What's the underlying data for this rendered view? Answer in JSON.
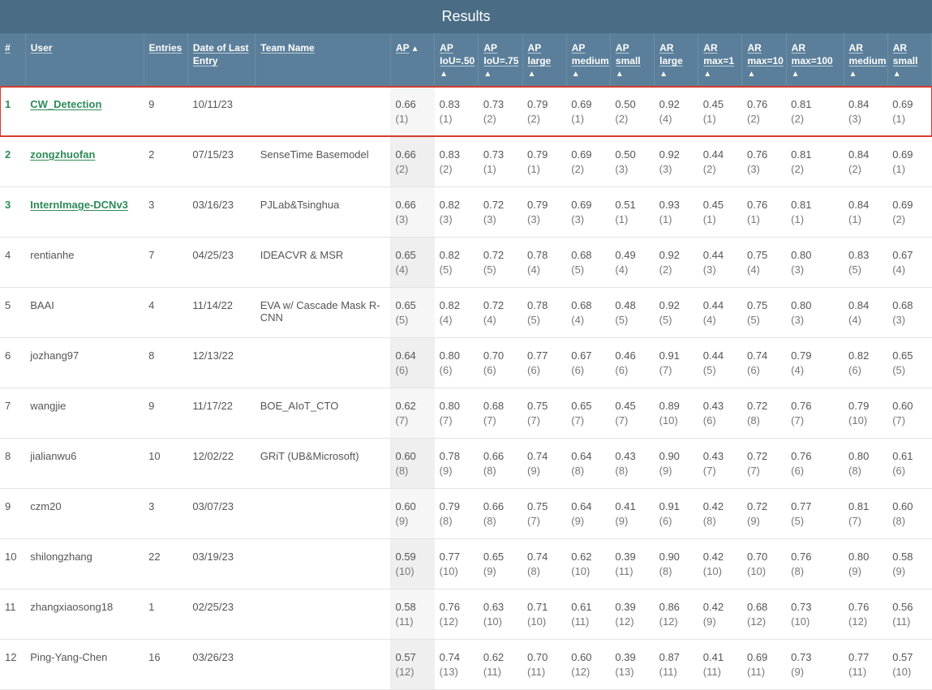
{
  "title": "Results",
  "columns": [
    {
      "label": "#",
      "sortable": false
    },
    {
      "label": "User",
      "sortable": false
    },
    {
      "label": "Entries",
      "sortable": false
    },
    {
      "label": "Date of Last Entry",
      "sortable": false
    },
    {
      "label": "Team Name",
      "sortable": false
    },
    {
      "label": "AP",
      "sortable": true,
      "arrow_inline": true
    },
    {
      "label": "AP IoU=.50",
      "sortable": true
    },
    {
      "label": "AP IoU=.75",
      "sortable": true
    },
    {
      "label": "AP large",
      "sortable": true
    },
    {
      "label": "AP medium",
      "sortable": true
    },
    {
      "label": "AP small",
      "sortable": true
    },
    {
      "label": "AR large",
      "sortable": true
    },
    {
      "label": "AR max=1",
      "sortable": true
    },
    {
      "label": "AR max=10",
      "sortable": true
    },
    {
      "label": "AR max=100",
      "sortable": true
    },
    {
      "label": "AR medium",
      "sortable": true
    },
    {
      "label": "AR small",
      "sortable": true
    }
  ],
  "rows": [
    {
      "rank": "1",
      "user": "CW_Detection",
      "top": true,
      "highlight": true,
      "entries": "9",
      "date": "10/11/23",
      "team": "",
      "metrics": [
        {
          "v": "0.66",
          "r": "(1)"
        },
        {
          "v": "0.83",
          "r": "(1)"
        },
        {
          "v": "0.73",
          "r": "(2)"
        },
        {
          "v": "0.79",
          "r": "(2)"
        },
        {
          "v": "0.69",
          "r": "(1)"
        },
        {
          "v": "0.50",
          "r": "(2)"
        },
        {
          "v": "0.92",
          "r": "(4)"
        },
        {
          "v": "0.45",
          "r": "(1)"
        },
        {
          "v": "0.76",
          "r": "(2)"
        },
        {
          "v": "0.81",
          "r": "(2)"
        },
        {
          "v": "0.84",
          "r": "(3)"
        },
        {
          "v": "0.69",
          "r": "(1)"
        }
      ]
    },
    {
      "rank": "2",
      "user": "zongzhuofan",
      "top": true,
      "entries": "2",
      "date": "07/15/23",
      "team": "SenseTime Basemodel",
      "metrics": [
        {
          "v": "0.66",
          "r": "(2)"
        },
        {
          "v": "0.83",
          "r": "(2)"
        },
        {
          "v": "0.73",
          "r": "(1)"
        },
        {
          "v": "0.79",
          "r": "(1)"
        },
        {
          "v": "0.69",
          "r": "(2)"
        },
        {
          "v": "0.50",
          "r": "(3)"
        },
        {
          "v": "0.92",
          "r": "(3)"
        },
        {
          "v": "0.44",
          "r": "(2)"
        },
        {
          "v": "0.76",
          "r": "(3)"
        },
        {
          "v": "0.81",
          "r": "(2)"
        },
        {
          "v": "0.84",
          "r": "(2)"
        },
        {
          "v": "0.69",
          "r": "(1)"
        }
      ]
    },
    {
      "rank": "3",
      "user": "InternImage-DCNv3",
      "top": true,
      "entries": "3",
      "date": "03/16/23",
      "team": "PJLab&Tsinghua",
      "metrics": [
        {
          "v": "0.66",
          "r": "(3)"
        },
        {
          "v": "0.82",
          "r": "(3)"
        },
        {
          "v": "0.72",
          "r": "(3)"
        },
        {
          "v": "0.79",
          "r": "(3)"
        },
        {
          "v": "0.69",
          "r": "(3)"
        },
        {
          "v": "0.51",
          "r": "(1)"
        },
        {
          "v": "0.93",
          "r": "(1)"
        },
        {
          "v": "0.45",
          "r": "(1)"
        },
        {
          "v": "0.76",
          "r": "(1)"
        },
        {
          "v": "0.81",
          "r": "(1)"
        },
        {
          "v": "0.84",
          "r": "(1)"
        },
        {
          "v": "0.69",
          "r": "(2)"
        }
      ]
    },
    {
      "rank": "4",
      "user": "rentianhe",
      "entries": "7",
      "date": "04/25/23",
      "team": "IDEACVR & MSR",
      "metrics": [
        {
          "v": "0.65",
          "r": "(4)"
        },
        {
          "v": "0.82",
          "r": "(5)"
        },
        {
          "v": "0.72",
          "r": "(5)"
        },
        {
          "v": "0.78",
          "r": "(4)"
        },
        {
          "v": "0.68",
          "r": "(5)"
        },
        {
          "v": "0.49",
          "r": "(4)"
        },
        {
          "v": "0.92",
          "r": "(2)"
        },
        {
          "v": "0.44",
          "r": "(3)"
        },
        {
          "v": "0.75",
          "r": "(4)"
        },
        {
          "v": "0.80",
          "r": "(3)"
        },
        {
          "v": "0.83",
          "r": "(5)"
        },
        {
          "v": "0.67",
          "r": "(4)"
        }
      ]
    },
    {
      "rank": "5",
      "user": "BAAI",
      "entries": "4",
      "date": "11/14/22",
      "team": "EVA w/ Cascade Mask R-CNN",
      "metrics": [
        {
          "v": "0.65",
          "r": "(5)"
        },
        {
          "v": "0.82",
          "r": "(4)"
        },
        {
          "v": "0.72",
          "r": "(4)"
        },
        {
          "v": "0.78",
          "r": "(5)"
        },
        {
          "v": "0.68",
          "r": "(4)"
        },
        {
          "v": "0.48",
          "r": "(5)"
        },
        {
          "v": "0.92",
          "r": "(5)"
        },
        {
          "v": "0.44",
          "r": "(4)"
        },
        {
          "v": "0.75",
          "r": "(5)"
        },
        {
          "v": "0.80",
          "r": "(3)"
        },
        {
          "v": "0.84",
          "r": "(4)"
        },
        {
          "v": "0.68",
          "r": "(3)"
        }
      ]
    },
    {
      "rank": "6",
      "user": "jozhang97",
      "entries": "8",
      "date": "12/13/22",
      "team": "",
      "metrics": [
        {
          "v": "0.64",
          "r": "(6)"
        },
        {
          "v": "0.80",
          "r": "(6)"
        },
        {
          "v": "0.70",
          "r": "(6)"
        },
        {
          "v": "0.77",
          "r": "(6)"
        },
        {
          "v": "0.67",
          "r": "(6)"
        },
        {
          "v": "0.46",
          "r": "(6)"
        },
        {
          "v": "0.91",
          "r": "(7)"
        },
        {
          "v": "0.44",
          "r": "(5)"
        },
        {
          "v": "0.74",
          "r": "(6)"
        },
        {
          "v": "0.79",
          "r": "(4)"
        },
        {
          "v": "0.82",
          "r": "(6)"
        },
        {
          "v": "0.65",
          "r": "(5)"
        }
      ]
    },
    {
      "rank": "7",
      "user": "wangjie",
      "entries": "9",
      "date": "11/17/22",
      "team": "BOE_AIoT_CTO",
      "metrics": [
        {
          "v": "0.62",
          "r": "(7)"
        },
        {
          "v": "0.80",
          "r": "(7)"
        },
        {
          "v": "0.68",
          "r": "(7)"
        },
        {
          "v": "0.75",
          "r": "(7)"
        },
        {
          "v": "0.65",
          "r": "(7)"
        },
        {
          "v": "0.45",
          "r": "(7)"
        },
        {
          "v": "0.89",
          "r": "(10)"
        },
        {
          "v": "0.43",
          "r": "(6)"
        },
        {
          "v": "0.72",
          "r": "(8)"
        },
        {
          "v": "0.76",
          "r": "(7)"
        },
        {
          "v": "0.79",
          "r": "(10)"
        },
        {
          "v": "0.60",
          "r": "(7)"
        }
      ]
    },
    {
      "rank": "8",
      "user": "jialianwu6",
      "entries": "10",
      "date": "12/02/22",
      "team": "GRiT (UB&Microsoft)",
      "metrics": [
        {
          "v": "0.60",
          "r": "(8)"
        },
        {
          "v": "0.78",
          "r": "(9)"
        },
        {
          "v": "0.66",
          "r": "(8)"
        },
        {
          "v": "0.74",
          "r": "(9)"
        },
        {
          "v": "0.64",
          "r": "(8)"
        },
        {
          "v": "0.43",
          "r": "(8)"
        },
        {
          "v": "0.90",
          "r": "(9)"
        },
        {
          "v": "0.43",
          "r": "(7)"
        },
        {
          "v": "0.72",
          "r": "(7)"
        },
        {
          "v": "0.76",
          "r": "(6)"
        },
        {
          "v": "0.80",
          "r": "(8)"
        },
        {
          "v": "0.61",
          "r": "(6)"
        }
      ]
    },
    {
      "rank": "9",
      "user": "czm20",
      "entries": "3",
      "date": "03/07/23",
      "team": "",
      "metrics": [
        {
          "v": "0.60",
          "r": "(9)"
        },
        {
          "v": "0.79",
          "r": "(8)"
        },
        {
          "v": "0.66",
          "r": "(8)"
        },
        {
          "v": "0.75",
          "r": "(7)"
        },
        {
          "v": "0.64",
          "r": "(9)"
        },
        {
          "v": "0.41",
          "r": "(9)"
        },
        {
          "v": "0.91",
          "r": "(6)"
        },
        {
          "v": "0.42",
          "r": "(8)"
        },
        {
          "v": "0.72",
          "r": "(9)"
        },
        {
          "v": "0.77",
          "r": "(5)"
        },
        {
          "v": "0.81",
          "r": "(7)"
        },
        {
          "v": "0.60",
          "r": "(8)"
        }
      ]
    },
    {
      "rank": "10",
      "user": "shilongzhang",
      "entries": "22",
      "date": "03/19/23",
      "team": "",
      "metrics": [
        {
          "v": "0.59",
          "r": "(10)"
        },
        {
          "v": "0.77",
          "r": "(10)"
        },
        {
          "v": "0.65",
          "r": "(9)"
        },
        {
          "v": "0.74",
          "r": "(8)"
        },
        {
          "v": "0.62",
          "r": "(10)"
        },
        {
          "v": "0.39",
          "r": "(11)"
        },
        {
          "v": "0.90",
          "r": "(8)"
        },
        {
          "v": "0.42",
          "r": "(10)"
        },
        {
          "v": "0.70",
          "r": "(10)"
        },
        {
          "v": "0.76",
          "r": "(8)"
        },
        {
          "v": "0.80",
          "r": "(9)"
        },
        {
          "v": "0.58",
          "r": "(9)"
        }
      ]
    },
    {
      "rank": "11",
      "user": "zhangxiaosong18",
      "entries": "1",
      "date": "02/25/23",
      "team": "",
      "metrics": [
        {
          "v": "0.58",
          "r": "(11)"
        },
        {
          "v": "0.76",
          "r": "(12)"
        },
        {
          "v": "0.63",
          "r": "(10)"
        },
        {
          "v": "0.71",
          "r": "(10)"
        },
        {
          "v": "0.61",
          "r": "(11)"
        },
        {
          "v": "0.39",
          "r": "(12)"
        },
        {
          "v": "0.86",
          "r": "(12)"
        },
        {
          "v": "0.42",
          "r": "(9)"
        },
        {
          "v": "0.68",
          "r": "(12)"
        },
        {
          "v": "0.73",
          "r": "(10)"
        },
        {
          "v": "0.76",
          "r": "(12)"
        },
        {
          "v": "0.56",
          "r": "(11)"
        }
      ]
    },
    {
      "rank": "12",
      "user": "Ping-Yang-Chen",
      "entries": "16",
      "date": "03/26/23",
      "team": "",
      "metrics": [
        {
          "v": "0.57",
          "r": "(12)"
        },
        {
          "v": "0.74",
          "r": "(13)"
        },
        {
          "v": "0.62",
          "r": "(11)"
        },
        {
          "v": "0.70",
          "r": "(11)"
        },
        {
          "v": "0.60",
          "r": "(12)"
        },
        {
          "v": "0.39",
          "r": "(13)"
        },
        {
          "v": "0.87",
          "r": "(11)"
        },
        {
          "v": "0.41",
          "r": "(11)"
        },
        {
          "v": "0.69",
          "r": "(11)"
        },
        {
          "v": "0.73",
          "r": "(9)"
        },
        {
          "v": "0.77",
          "r": "(11)"
        },
        {
          "v": "0.57",
          "r": "(10)"
        }
      ]
    }
  ],
  "chart_data": {
    "type": "table",
    "title": "Results",
    "columns": [
      "#",
      "User",
      "Entries",
      "Date of Last Entry",
      "Team Name",
      "AP",
      "AP IoU=.50",
      "AP IoU=.75",
      "AP large",
      "AP medium",
      "AP small",
      "AR large",
      "AR max=1",
      "AR max=10",
      "AR max=100",
      "AR medium",
      "AR small"
    ],
    "rows": [
      [
        1,
        "CW_Detection",
        9,
        "10/11/23",
        "",
        0.66,
        0.83,
        0.73,
        0.79,
        0.69,
        0.5,
        0.92,
        0.45,
        0.76,
        0.81,
        0.84,
        0.69
      ],
      [
        2,
        "zongzhuofan",
        2,
        "07/15/23",
        "SenseTime Basemodel",
        0.66,
        0.83,
        0.73,
        0.79,
        0.69,
        0.5,
        0.92,
        0.44,
        0.76,
        0.81,
        0.84,
        0.69
      ],
      [
        3,
        "InternImage-DCNv3",
        3,
        "03/16/23",
        "PJLab&Tsinghua",
        0.66,
        0.82,
        0.72,
        0.79,
        0.69,
        0.51,
        0.93,
        0.45,
        0.76,
        0.81,
        0.84,
        0.69
      ],
      [
        4,
        "rentianhe",
        7,
        "04/25/23",
        "IDEACVR & MSR",
        0.65,
        0.82,
        0.72,
        0.78,
        0.68,
        0.49,
        0.92,
        0.44,
        0.75,
        0.8,
        0.83,
        0.67
      ],
      [
        5,
        "BAAI",
        4,
        "11/14/22",
        "EVA w/ Cascade Mask R-CNN",
        0.65,
        0.82,
        0.72,
        0.78,
        0.68,
        0.48,
        0.92,
        0.44,
        0.75,
        0.8,
        0.84,
        0.68
      ],
      [
        6,
        "jozhang97",
        8,
        "12/13/22",
        "",
        0.64,
        0.8,
        0.7,
        0.77,
        0.67,
        0.46,
        0.91,
        0.44,
        0.74,
        0.79,
        0.82,
        0.65
      ],
      [
        7,
        "wangjie",
        9,
        "11/17/22",
        "BOE_AIoT_CTO",
        0.62,
        0.8,
        0.68,
        0.75,
        0.65,
        0.45,
        0.89,
        0.43,
        0.72,
        0.76,
        0.79,
        0.6
      ],
      [
        8,
        "jialianwu6",
        10,
        "12/02/22",
        "GRiT (UB&Microsoft)",
        0.6,
        0.78,
        0.66,
        0.74,
        0.64,
        0.43,
        0.9,
        0.43,
        0.72,
        0.76,
        0.8,
        0.61
      ],
      [
        9,
        "czm20",
        3,
        "03/07/23",
        "",
        0.6,
        0.79,
        0.66,
        0.75,
        0.64,
        0.41,
        0.91,
        0.42,
        0.72,
        0.77,
        0.81,
        0.6
      ],
      [
        10,
        "shilongzhang",
        22,
        "03/19/23",
        "",
        0.59,
        0.77,
        0.65,
        0.74,
        0.62,
        0.39,
        0.9,
        0.42,
        0.7,
        0.76,
        0.8,
        0.58
      ],
      [
        11,
        "zhangxiaosong18",
        1,
        "02/25/23",
        "",
        0.58,
        0.76,
        0.63,
        0.71,
        0.61,
        0.39,
        0.86,
        0.42,
        0.68,
        0.73,
        0.76,
        0.56
      ],
      [
        12,
        "Ping-Yang-Chen",
        16,
        "03/26/23",
        "",
        0.57,
        0.74,
        0.62,
        0.7,
        0.6,
        0.39,
        0.87,
        0.41,
        0.69,
        0.73,
        0.77,
        0.57
      ]
    ]
  }
}
